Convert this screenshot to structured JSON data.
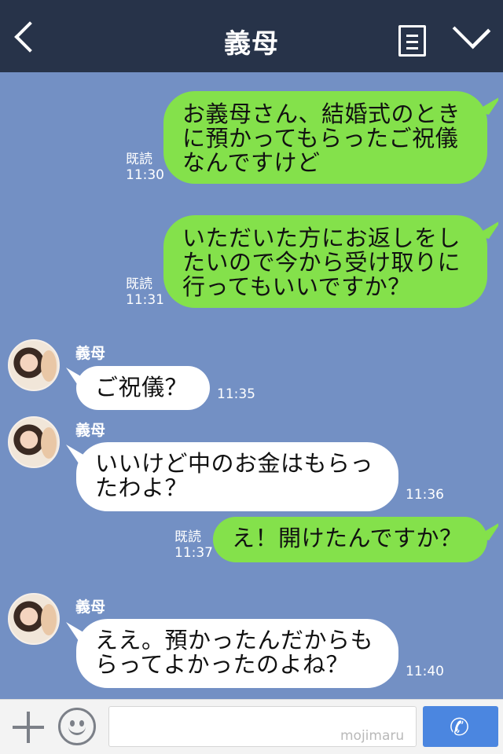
{
  "header": {
    "title": "義母"
  },
  "messages": [
    {
      "text": "お義母さん、結婚式のときに預かってもらったご祝儀なんですけど",
      "read": "既読",
      "time": "11:30"
    },
    {
      "text": "いただいた方にお返しをしたいので今から受け取りに行ってもいいですか？",
      "read": "既読",
      "time": "11:31"
    },
    {
      "sender": "義母",
      "text": "ご祝儀？",
      "time": "11:35"
    },
    {
      "sender": "義母",
      "text": "いいけど中のお金はもらったわよ？",
      "time": "11:36"
    },
    {
      "text": "え！開けたんですか？",
      "read": "既読",
      "time": "11:37"
    },
    {
      "sender": "義母",
      "text": "ええ。預かったんだからもらってよかったのよね？",
      "time": "11:40"
    }
  ],
  "bottom": {
    "input_value": "",
    "watermark": "mojimaru"
  },
  "colors": {
    "header": "#273349",
    "background": "#7390c4",
    "sent_bubble": "#84e14b",
    "received_bubble": "#ffffff",
    "call_button": "#4b86e0"
  },
  "icons": [
    "back-icon",
    "menu-icon",
    "chevron-down-icon",
    "plus-icon",
    "smile-icon",
    "phone-icon"
  ]
}
